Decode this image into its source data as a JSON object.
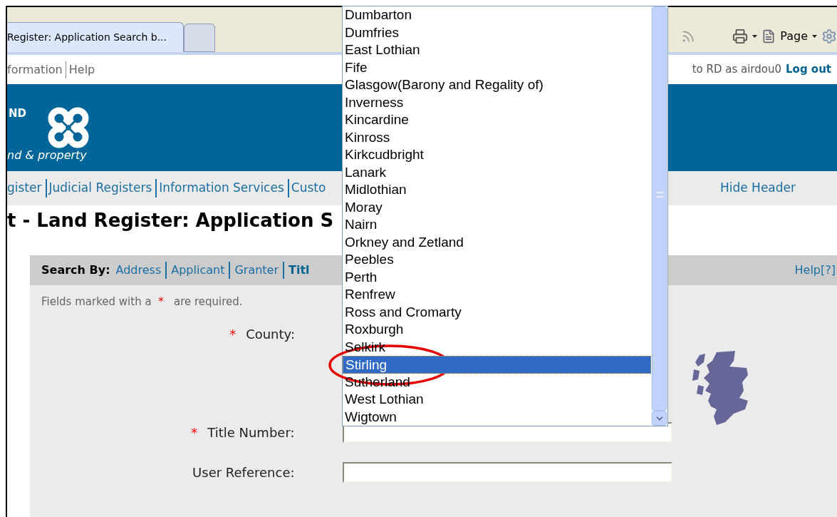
{
  "browser": {
    "tabs": [
      {
        "label": "Register: Application Search b...",
        "selected": true
      }
    ],
    "page_menu": "Page"
  },
  "top_links": [
    "formation",
    "Help"
  ],
  "session": {
    "text": "to RD as airdou0",
    "logout": "Log out"
  },
  "banner": {
    "brand": "ND",
    "tagline": "nd & property"
  },
  "nav": {
    "items": [
      "gister",
      "Judicial Registers",
      "Information Services",
      "Custo"
    ],
    "hide_header": "Hide Header"
  },
  "page_title": "t - Land Register: Application S",
  "search_by": {
    "label": "Search By:",
    "options": [
      {
        "label": "Address",
        "selected": false
      },
      {
        "label": "Applicant",
        "selected": false
      },
      {
        "label": "Granter",
        "selected": false
      },
      {
        "label": "Titl",
        "selected": true
      }
    ],
    "help": "Help[?]"
  },
  "required_note": {
    "before": "Fields marked with a",
    "marker": "*",
    "after": "are required."
  },
  "fields": [
    {
      "kind": "select",
      "label": "County:",
      "marker": "*",
      "options": [
        {
          "label": "Dumbarton",
          "selected": false
        },
        {
          "label": "Dumfries",
          "selected": false
        },
        {
          "label": "East Lothian",
          "selected": false
        },
        {
          "label": "Fife",
          "selected": false
        },
        {
          "label": "Glasgow(Barony and Regality of)",
          "selected": false
        },
        {
          "label": "Inverness",
          "selected": false
        },
        {
          "label": "Kincardine",
          "selected": false
        },
        {
          "label": "Kinross",
          "selected": false
        },
        {
          "label": "Kirkcudbright",
          "selected": false
        },
        {
          "label": "Lanark",
          "selected": false
        },
        {
          "label": "Midlothian",
          "selected": false
        },
        {
          "label": "Moray",
          "selected": false
        },
        {
          "label": "Nairn",
          "selected": false
        },
        {
          "label": "Orkney and Zetland",
          "selected": false
        },
        {
          "label": "Peebles",
          "selected": false
        },
        {
          "label": "Perth",
          "selected": false
        },
        {
          "label": "Renfrew",
          "selected": false
        },
        {
          "label": "Ross and Cromarty",
          "selected": false
        },
        {
          "label": "Roxburgh",
          "selected": false
        },
        {
          "label": "Selkirk",
          "selected": false
        },
        {
          "label": "Stirling",
          "selected": true
        },
        {
          "label": "Sutherland",
          "selected": false
        },
        {
          "label": "West Lothian",
          "selected": false
        },
        {
          "label": "Wigtown",
          "selected": false
        }
      ]
    },
    {
      "kind": "text",
      "label": "Title Number:",
      "marker": "*"
    },
    {
      "kind": "text",
      "label": "User Reference:"
    }
  ]
}
